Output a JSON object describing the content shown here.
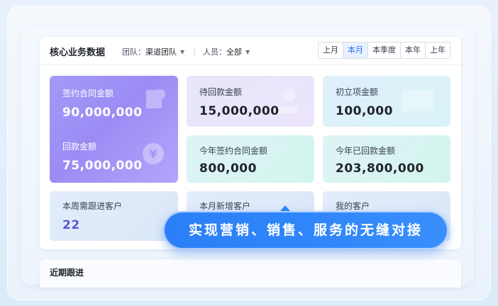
{
  "panel": {
    "title": "核心业务数据",
    "team_label": "团队：",
    "team_value": "渠道团队",
    "person_label": "人员：",
    "person_value": "全部",
    "periods": [
      "上月",
      "本月",
      "本季度",
      "本年",
      "上年"
    ],
    "active_period": "本月"
  },
  "cards": {
    "signed_contract": {
      "label": "签约合同金额",
      "value": "90,000,000"
    },
    "payment_received": {
      "label": "回款金额",
      "value": "75,000,000"
    },
    "pending_payment": {
      "label": "待回款金额",
      "value": "15,000,000"
    },
    "initial_project": {
      "label": "初立项金额",
      "value": "100,000"
    },
    "year_signed": {
      "label": "今年签约合同金额",
      "value": "800,000"
    },
    "year_received": {
      "label": "今年已回款金额",
      "value": "203,800,000"
    },
    "week_followup": {
      "label": "本周需跟进客户",
      "value": "22"
    },
    "month_new": {
      "label": "本月新增客户"
    },
    "my_customers": {
      "label": "我的客户"
    }
  },
  "recent": {
    "title": "近期跟进"
  },
  "banner": {
    "text": "实现营销、销售、服务的无缝对接"
  },
  "colors": {
    "accent": "#2f6bff",
    "banner": "#2f86fa",
    "card_primary": "#9b8cf4"
  }
}
